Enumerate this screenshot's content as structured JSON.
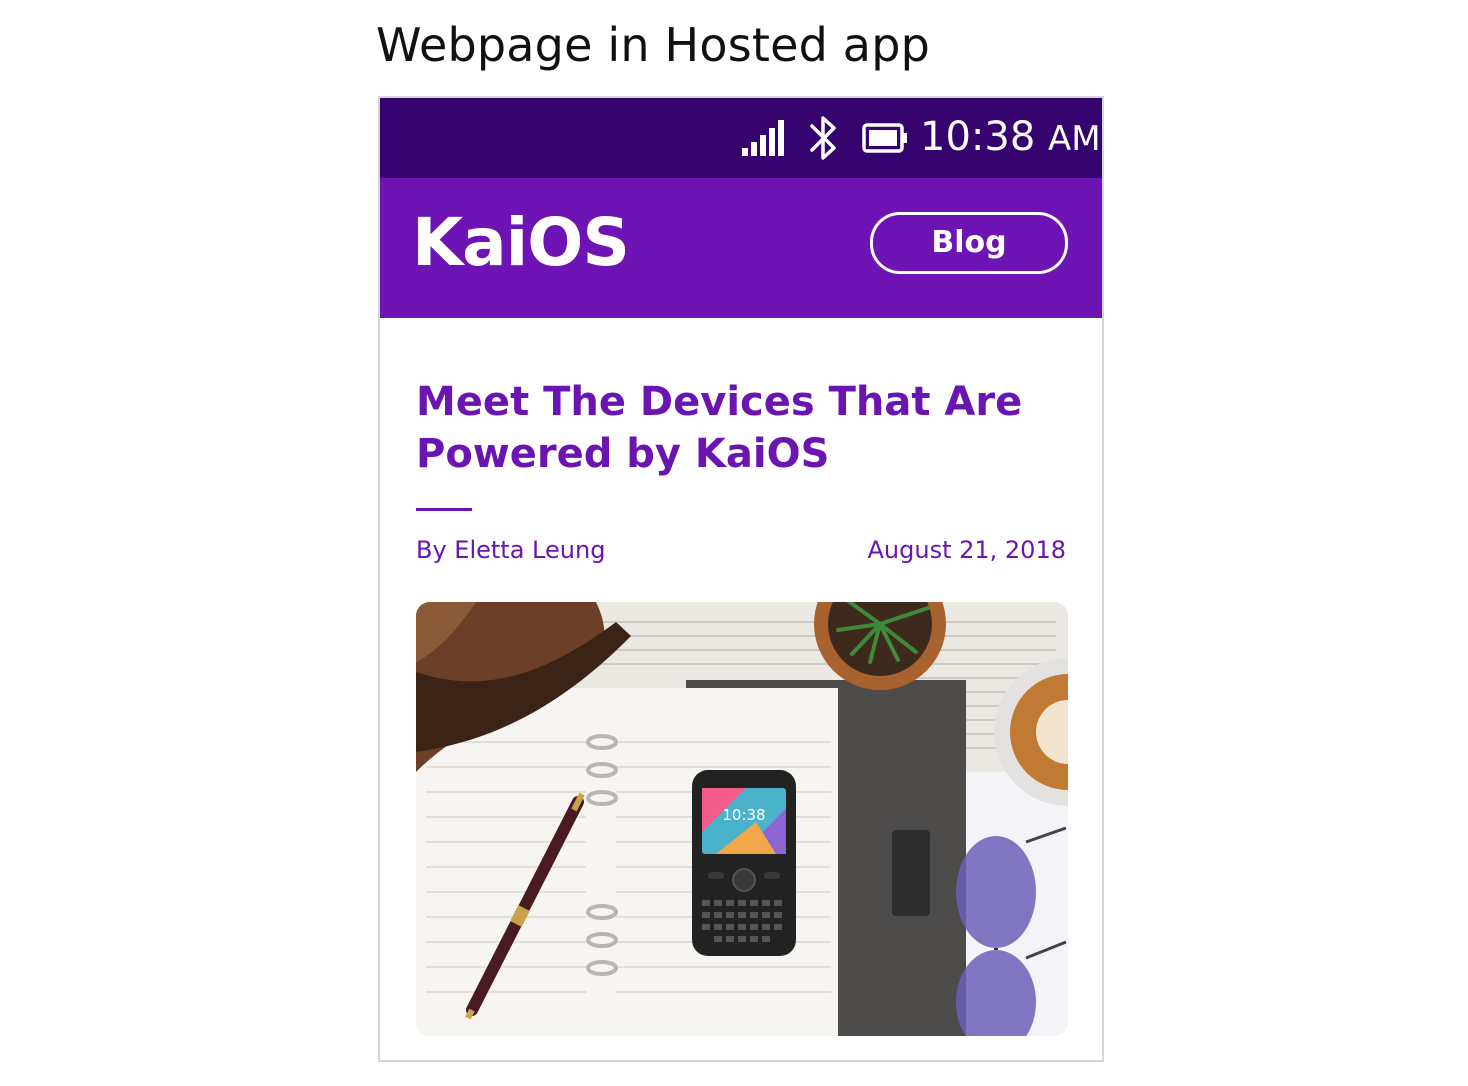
{
  "caption": "Webpage in Hosted app",
  "status_bar": {
    "time": "10:38",
    "ampm": "AM",
    "icons": [
      "signal-icon",
      "bluetooth-icon",
      "battery-icon"
    ]
  },
  "header": {
    "logo": "KaiOS",
    "blog_button": "Blog"
  },
  "article": {
    "title": "Meet The Devices That Are Powered by KaiOS",
    "author": "By Eletta Leung",
    "date": "August 21, 2018",
    "hero_image": "flat-lay photo of a KaiOS feature phone on an open notebook with pen, bag, plant, coffee and sunglasses",
    "phone_screen_time": "10:38"
  },
  "colors": {
    "status_bar": "#34036e",
    "header": "#6f14b4",
    "accent": "#6a15b2"
  }
}
